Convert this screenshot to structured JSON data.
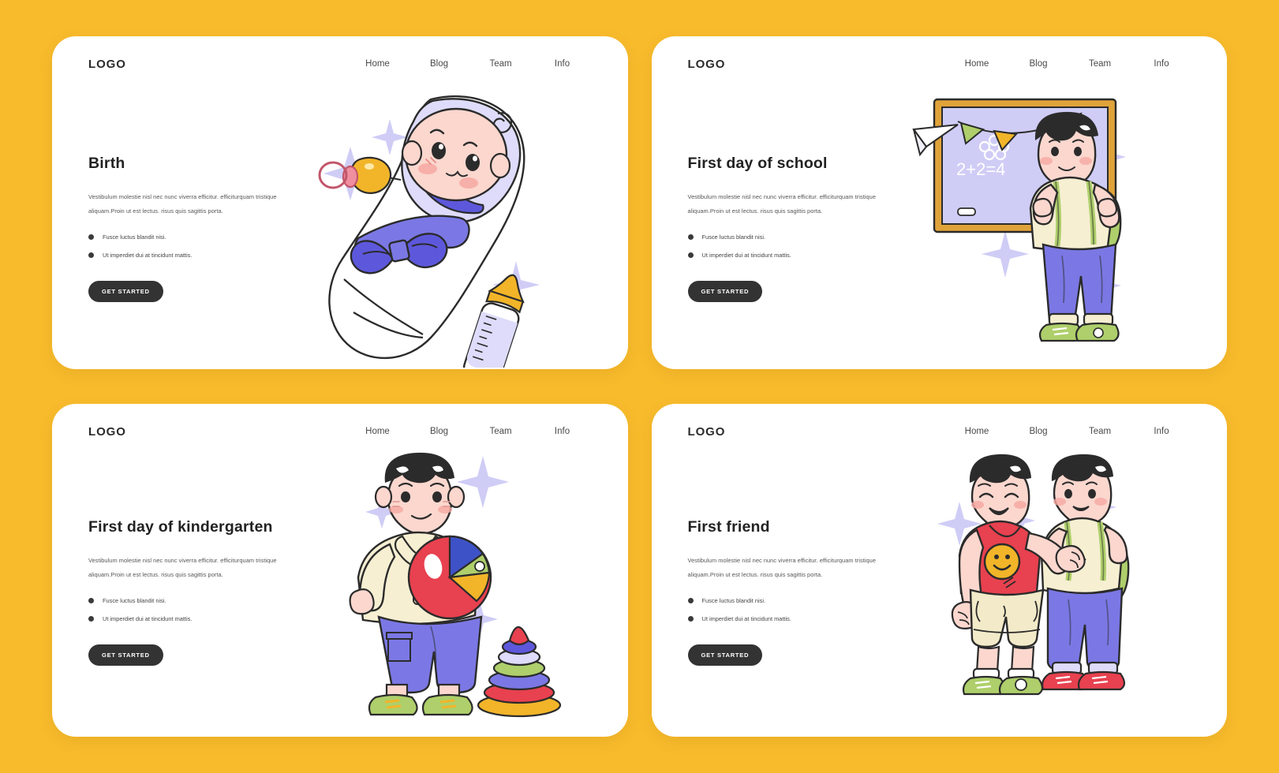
{
  "page": {
    "background_color": "#F8BB2C",
    "card_background": "#FFFFFF",
    "accent_dark": "#333333",
    "accent_purple": "#7B78E5",
    "accent_lavender": "#CFCDF6",
    "accent_green": "#AECF6B",
    "accent_red": "#E8414F",
    "accent_yellow": "#F2B529",
    "accent_cream": "#F6EFD2",
    "skin": "#FBD7CE"
  },
  "nav": {
    "logo": "LOGO",
    "links": [
      "Home",
      "Blog",
      "Team",
      "Info"
    ]
  },
  "shared": {
    "paragraph": "Vestibulum molestie nisl nec nunc viverra efficitur. efficiturquam tristique aliquam.Proin ut est lectus. risus quis sagittis porta.",
    "bullets": [
      "Fusce luctus blandit nisi.",
      "Ut imperdiet dui at tincidunt mattis."
    ],
    "cta_label": "GET STARTED"
  },
  "cards": [
    {
      "id": "birth",
      "title": "Birth",
      "illustration": "swaddled-baby-with-pacifier-and-bottle"
    },
    {
      "id": "first-day-of-school",
      "title": "First day of school",
      "illustration": "boy-with-backpack-in-front-of-chalkboard",
      "chalkboard_text": "2+2=4"
    },
    {
      "id": "first-day-of-kindergarten",
      "title": "First day of kindergarten",
      "illustration": "boy-holding-beach-ball-with-stacking-ring-toy"
    },
    {
      "id": "first-friend",
      "title": "First friend",
      "illustration": "two-boys-arm-in-arm-one-with-smiley-shirt"
    }
  ]
}
